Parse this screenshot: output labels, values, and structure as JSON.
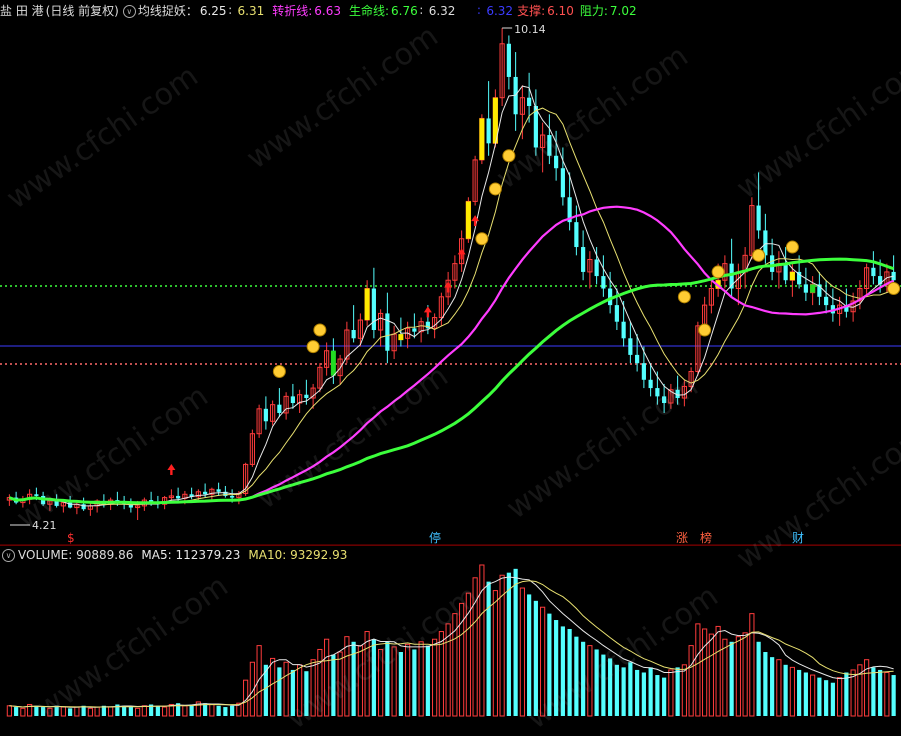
{
  "header": {
    "stock_name": "盐 田 港",
    "mode": "(日线 前复权)",
    "collapse_glyph": "∨",
    "indicator_label": "均线捉妖：",
    "ma_a": "6.25",
    "ma_b": "6.31",
    "turn_label": "转折线:",
    "turn_value": "6.63",
    "life_label": "生命线:",
    "life_value": "6.76",
    "extra_value": "6.32",
    "extra_value2": "6.32",
    "support_label": "支撑:",
    "support_value": "6.10",
    "resist_label": "阻力:",
    "resist_value": "7.02"
  },
  "price_labels": {
    "high": "10.14",
    "low": "4.21"
  },
  "events": [
    {
      "label": "$",
      "color": "#ff3030"
    },
    {
      "label": "停",
      "color": "#40c0ff"
    },
    {
      "label": "涨",
      "color": "#ff6040"
    },
    {
      "label": "榜",
      "color": "#ff6040"
    },
    {
      "label": "财",
      "color": "#40c0ff"
    }
  ],
  "volume_header": {
    "label": "VOLUME:",
    "value": "90889.86",
    "ma5_label": "MA5:",
    "ma5_value": "112379.23",
    "ma10_label": "MA10:",
    "ma10_value": "93292.93"
  },
  "watermark": "www.cfchi.com",
  "colors": {
    "up": "#ff3c3c",
    "down": "#54ffff",
    "ma_white": "#e8e8e8",
    "ma_yellow": "#e8e070",
    "ma_magenta": "#ff3cff",
    "ma_green": "#3cff3c",
    "support_line": "#3c3cff"
  },
  "chart_data": {
    "type": "candlestick",
    "y_range": [
      4.21,
      10.14
    ],
    "series": [
      {
        "name": "均线捉妖",
        "values": []
      },
      {
        "name": "转折线",
        "values": []
      },
      {
        "name": "生命线",
        "values": []
      }
    ],
    "bars": [
      [
        4.45,
        4.52,
        4.38,
        4.48
      ],
      [
        4.48,
        4.55,
        4.4,
        4.42
      ],
      [
        4.42,
        4.5,
        4.36,
        4.46
      ],
      [
        4.46,
        4.58,
        4.4,
        4.52
      ],
      [
        4.52,
        4.6,
        4.45,
        4.5
      ],
      [
        4.5,
        4.55,
        4.38,
        4.4
      ],
      [
        4.4,
        4.48,
        4.32,
        4.44
      ],
      [
        4.44,
        4.52,
        4.36,
        4.38
      ],
      [
        4.38,
        4.46,
        4.3,
        4.42
      ],
      [
        4.42,
        4.5,
        4.35,
        4.36
      ],
      [
        4.36,
        4.44,
        4.28,
        4.4
      ],
      [
        4.4,
        4.48,
        4.32,
        4.34
      ],
      [
        4.34,
        4.42,
        4.26,
        4.38
      ],
      [
        4.38,
        4.46,
        4.3,
        4.44
      ],
      [
        4.44,
        4.52,
        4.36,
        4.4
      ],
      [
        4.4,
        4.48,
        4.33,
        4.45
      ],
      [
        4.45,
        4.55,
        4.38,
        4.42
      ],
      [
        4.42,
        4.5,
        4.34,
        4.4
      ],
      [
        4.4,
        4.47,
        4.3,
        4.36
      ],
      [
        4.36,
        4.44,
        4.21,
        4.38
      ],
      [
        4.38,
        4.48,
        4.32,
        4.45
      ],
      [
        4.45,
        4.55,
        4.38,
        4.42
      ],
      [
        4.42,
        4.5,
        4.35,
        4.4
      ],
      [
        4.4,
        4.5,
        4.34,
        4.48
      ],
      [
        4.48,
        4.58,
        4.42,
        4.5
      ],
      [
        4.5,
        4.6,
        4.44,
        4.47
      ],
      [
        4.47,
        4.56,
        4.4,
        4.52
      ],
      [
        4.52,
        4.6,
        4.46,
        4.49
      ],
      [
        4.49,
        4.58,
        4.42,
        4.55
      ],
      [
        4.55,
        4.65,
        4.48,
        4.52
      ],
      [
        4.52,
        4.6,
        4.45,
        4.58
      ],
      [
        4.58,
        4.66,
        4.5,
        4.55
      ],
      [
        4.55,
        4.62,
        4.48,
        4.5
      ],
      [
        4.5,
        4.58,
        4.42,
        4.48
      ],
      [
        4.48,
        4.56,
        4.4,
        4.53
      ],
      [
        4.53,
        4.9,
        4.5,
        4.88
      ],
      [
        4.88,
        5.3,
        4.85,
        5.25
      ],
      [
        5.25,
        5.6,
        5.2,
        5.55
      ],
      [
        5.55,
        5.7,
        5.3,
        5.4
      ],
      [
        5.4,
        5.65,
        5.35,
        5.6
      ],
      [
        5.6,
        5.8,
        5.45,
        5.5
      ],
      [
        5.5,
        5.75,
        5.42,
        5.7
      ],
      [
        5.7,
        5.85,
        5.55,
        5.62
      ],
      [
        5.62,
        5.78,
        5.5,
        5.72
      ],
      [
        5.72,
        5.9,
        5.6,
        5.68
      ],
      [
        5.68,
        5.85,
        5.55,
        5.8
      ],
      [
        5.8,
        6.1,
        5.75,
        6.05
      ],
      [
        6.05,
        6.35,
        5.95,
        6.25
      ],
      [
        6.25,
        6.4,
        5.85,
        5.95
      ],
      [
        5.95,
        6.2,
        5.85,
        6.15
      ],
      [
        6.15,
        6.6,
        6.1,
        6.5
      ],
      [
        6.5,
        6.8,
        6.35,
        6.4
      ],
      [
        6.4,
        6.7,
        6.3,
        6.62
      ],
      [
        6.62,
        7.1,
        6.55,
        7.0
      ],
      [
        7.0,
        7.25,
        6.4,
        6.5
      ],
      [
        6.5,
        6.75,
        6.3,
        6.7
      ],
      [
        6.7,
        6.95,
        6.1,
        6.25
      ],
      [
        6.25,
        6.55,
        6.15,
        6.45
      ],
      [
        6.45,
        6.65,
        6.3,
        6.4
      ],
      [
        6.4,
        6.6,
        6.28,
        6.52
      ],
      [
        6.52,
        6.7,
        6.4,
        6.48
      ],
      [
        6.48,
        6.65,
        6.35,
        6.6
      ],
      [
        6.6,
        6.8,
        6.45,
        6.52
      ],
      [
        6.52,
        6.7,
        6.4,
        6.65
      ],
      [
        6.65,
        6.95,
        6.55,
        6.9
      ],
      [
        6.9,
        7.2,
        6.8,
        7.1
      ],
      [
        7.1,
        7.4,
        7.0,
        7.3
      ],
      [
        7.3,
        7.7,
        7.2,
        7.6
      ],
      [
        7.6,
        8.1,
        7.55,
        8.05
      ],
      [
        8.05,
        8.6,
        8.0,
        8.55
      ],
      [
        8.55,
        9.1,
        8.5,
        9.05
      ],
      [
        9.05,
        9.5,
        8.6,
        8.75
      ],
      [
        8.75,
        9.4,
        8.7,
        9.3
      ],
      [
        9.3,
        10.14,
        9.2,
        9.95
      ],
      [
        9.95,
        10.05,
        9.4,
        9.55
      ],
      [
        9.55,
        9.85,
        8.9,
        9.1
      ],
      [
        9.1,
        9.45,
        8.8,
        9.3
      ],
      [
        9.3,
        9.6,
        9.0,
        9.2
      ],
      [
        9.2,
        9.4,
        8.6,
        8.7
      ],
      [
        8.7,
        9.0,
        8.4,
        8.85
      ],
      [
        8.85,
        9.1,
        8.5,
        8.6
      ],
      [
        8.6,
        8.9,
        8.3,
        8.45
      ],
      [
        8.45,
        8.7,
        8.0,
        8.1
      ],
      [
        8.1,
        8.4,
        7.7,
        7.8
      ],
      [
        7.8,
        8.0,
        7.4,
        7.5
      ],
      [
        7.5,
        7.7,
        7.1,
        7.2
      ],
      [
        7.2,
        7.45,
        7.0,
        7.35
      ],
      [
        7.35,
        7.5,
        7.05,
        7.15
      ],
      [
        7.15,
        7.4,
        6.9,
        7.0
      ],
      [
        7.0,
        7.2,
        6.7,
        6.8
      ],
      [
        6.8,
        7.0,
        6.5,
        6.6
      ],
      [
        6.6,
        6.85,
        6.3,
        6.4
      ],
      [
        6.4,
        6.6,
        6.1,
        6.2
      ],
      [
        6.2,
        6.45,
        6.0,
        6.1
      ],
      [
        6.1,
        6.3,
        5.8,
        5.9
      ],
      [
        5.9,
        6.1,
        5.7,
        5.8
      ],
      [
        5.8,
        6.0,
        5.6,
        5.7
      ],
      [
        5.7,
        5.85,
        5.5,
        5.62
      ],
      [
        5.62,
        5.85,
        5.55,
        5.78
      ],
      [
        5.78,
        5.95,
        5.6,
        5.68
      ],
      [
        5.68,
        5.9,
        5.58,
        5.82
      ],
      [
        5.82,
        6.05,
        5.75,
        6.0
      ],
      [
        6.0,
        6.6,
        5.95,
        6.55
      ],
      [
        6.55,
        6.9,
        6.45,
        6.8
      ],
      [
        6.8,
        7.1,
        6.7,
        7.0
      ],
      [
        7.0,
        7.3,
        6.9,
        7.1
      ],
      [
        7.1,
        7.4,
        7.0,
        7.3
      ],
      [
        7.3,
        7.6,
        6.9,
        7.0
      ],
      [
        7.0,
        7.3,
        6.8,
        7.2
      ],
      [
        7.2,
        7.5,
        7.0,
        7.4
      ],
      [
        7.4,
        8.1,
        7.35,
        8.0
      ],
      [
        8.0,
        8.4,
        7.6,
        7.7
      ],
      [
        7.7,
        7.9,
        7.3,
        7.4
      ],
      [
        7.4,
        7.6,
        7.1,
        7.2
      ],
      [
        7.2,
        7.45,
        7.0,
        7.3
      ],
      [
        7.3,
        7.5,
        7.05,
        7.1
      ],
      [
        7.1,
        7.3,
        6.9,
        7.2
      ],
      [
        7.2,
        7.4,
        7.0,
        7.05
      ],
      [
        7.05,
        7.25,
        6.85,
        6.95
      ],
      [
        6.95,
        7.15,
        6.8,
        7.05
      ],
      [
        7.05,
        7.2,
        6.8,
        6.9
      ],
      [
        6.9,
        7.1,
        6.7,
        6.8
      ],
      [
        6.8,
        7.0,
        6.6,
        6.7
      ],
      [
        6.7,
        6.9,
        6.55,
        6.8
      ],
      [
        6.8,
        7.0,
        6.65,
        6.72
      ],
      [
        6.72,
        6.95,
        6.6,
        6.85
      ],
      [
        6.85,
        7.1,
        6.75,
        7.0
      ],
      [
        7.0,
        7.3,
        6.9,
        7.25
      ],
      [
        7.25,
        7.45,
        7.05,
        7.15
      ],
      [
        7.15,
        7.35,
        6.95,
        7.05
      ],
      [
        7.05,
        7.3,
        6.95,
        7.2
      ],
      [
        7.2,
        7.4,
        7.0,
        7.1
      ]
    ],
    "volume": [
      8,
      7,
      6,
      9,
      8,
      7,
      6,
      8,
      7,
      6,
      7,
      8,
      6,
      7,
      8,
      7,
      9,
      8,
      7,
      6,
      8,
      9,
      8,
      7,
      9,
      10,
      8,
      9,
      11,
      10,
      9,
      8,
      7,
      8,
      10,
      28,
      42,
      55,
      40,
      45,
      38,
      42,
      36,
      40,
      35,
      44,
      52,
      60,
      48,
      50,
      62,
      58,
      55,
      66,
      60,
      52,
      58,
      54,
      50,
      56,
      52,
      58,
      55,
      60,
      66,
      72,
      80,
      88,
      96,
      108,
      118,
      105,
      98,
      110,
      112,
      115,
      100,
      95,
      90,
      85,
      80,
      75,
      70,
      68,
      62,
      58,
      55,
      52,
      48,
      45,
      40,
      38,
      42,
      36,
      34,
      38,
      32,
      30,
      36,
      38,
      40,
      55,
      72,
      68,
      64,
      70,
      60,
      58,
      62,
      65,
      80,
      58,
      50,
      46,
      44,
      40,
      38,
      36,
      34,
      32,
      30,
      28,
      26,
      30,
      34,
      36,
      40,
      44,
      38,
      36,
      34,
      32
    ],
    "volume_ma5": [],
    "volume_ma10": []
  }
}
